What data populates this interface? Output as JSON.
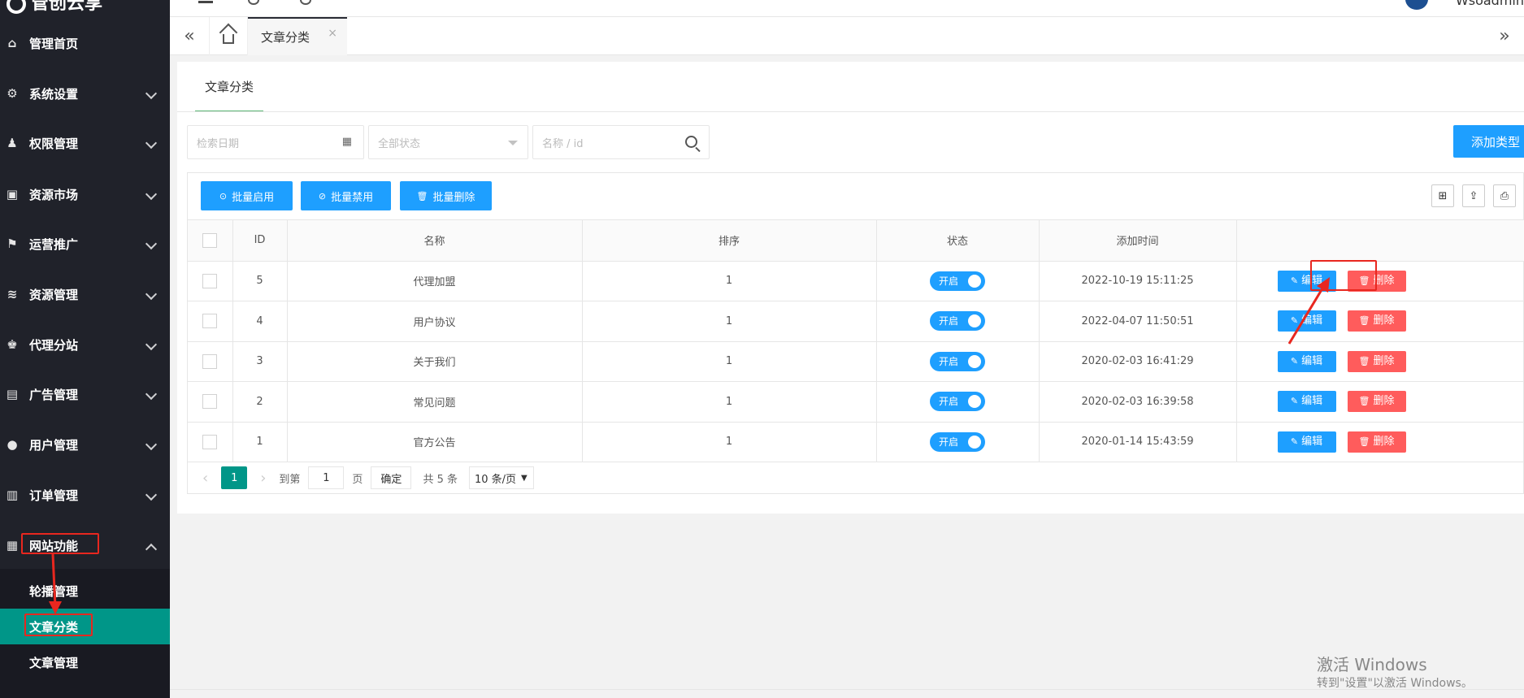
{
  "app": {
    "logo_text": "管创云享",
    "user_name": "Wsoadmin"
  },
  "sidebar": {
    "items": [
      {
        "icon": "home-icon",
        "glyph": "⌂",
        "label": "管理首页",
        "has_arrow": false
      },
      {
        "icon": "gear-icon",
        "glyph": "⚙",
        "label": "系统设置",
        "has_arrow": true
      },
      {
        "icon": "key-user-icon",
        "glyph": "♟",
        "label": "权限管理",
        "has_arrow": true
      },
      {
        "icon": "store-icon",
        "glyph": "▣",
        "label": "资源市场",
        "has_arrow": true
      },
      {
        "icon": "flag-icon",
        "glyph": "⚑",
        "label": "运营推广",
        "has_arrow": true
      },
      {
        "icon": "layers-icon",
        "glyph": "≋",
        "label": "资源管理",
        "has_arrow": true
      },
      {
        "icon": "agent-icon",
        "glyph": "♚",
        "label": "代理分站",
        "has_arrow": true
      },
      {
        "icon": "ad-icon",
        "glyph": "▤",
        "label": "广告管理",
        "has_arrow": true
      },
      {
        "icon": "user-icon",
        "glyph": "●",
        "label": "用户管理",
        "has_arrow": true
      },
      {
        "icon": "order-icon",
        "glyph": "▥",
        "label": "订单管理",
        "has_arrow": true
      },
      {
        "icon": "grid-icon",
        "glyph": "▦",
        "label": "网站功能",
        "has_arrow": true,
        "expanded": true
      }
    ],
    "subitems": [
      {
        "label": "轮播管理",
        "active": false
      },
      {
        "label": "文章分类",
        "active": true
      },
      {
        "label": "文章管理",
        "active": false
      }
    ]
  },
  "tabs": {
    "active_label": "文章分类",
    "close_glyph": "×"
  },
  "page": {
    "tab_title": "文章分类",
    "filters": {
      "date_placeholder": "检索日期",
      "status_placeholder": "全部状态",
      "name_placeholder": "名称 / id"
    },
    "add_button": "添加类型",
    "toolbar": {
      "enable": "批量启用",
      "disable": "批量禁用",
      "delete": "批量删除"
    },
    "table": {
      "headers": [
        "",
        "ID",
        "名称",
        "排序",
        "状态",
        "添加时间",
        ""
      ],
      "rows": [
        {
          "id": "5",
          "name": "代理加盟",
          "sort": "1",
          "status": "开启",
          "time": "2022-10-19 15:11:25"
        },
        {
          "id": "4",
          "name": "用户协议",
          "sort": "1",
          "status": "开启",
          "time": "2022-04-07 11:50:51"
        },
        {
          "id": "3",
          "name": "关于我们",
          "sort": "1",
          "status": "开启",
          "time": "2020-02-03 16:41:29"
        },
        {
          "id": "2",
          "name": "常见问题",
          "sort": "1",
          "status": "开启",
          "time": "2020-02-03 16:39:58"
        },
        {
          "id": "1",
          "name": "官方公告",
          "sort": "1",
          "status": "开启",
          "time": "2020-01-14 15:43:59"
        }
      ],
      "edit_label": "编辑",
      "delete_label": "删除"
    },
    "pager": {
      "current": "1",
      "goto_label": "到第",
      "goto_value": "1",
      "page_label": "页",
      "confirm": "确定",
      "total": "共 5 条",
      "page_size": "10 条/页"
    }
  },
  "watermark": {
    "title": "激活 Windows",
    "subtitle": "转到\"设置\"以激活 Windows。"
  },
  "colors": {
    "accent": "#1e9fff",
    "active_menu": "#009688",
    "danger": "#ff5c5c",
    "annotation": "#e8271f"
  }
}
